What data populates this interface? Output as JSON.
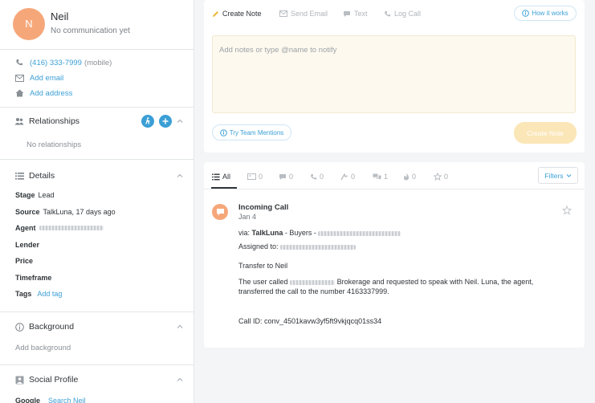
{
  "contact": {
    "initial": "N",
    "name": "Neil",
    "subtitle": "No communication yet",
    "phone": "(416) 333-7999",
    "phone_type": "(mobile)",
    "add_email": "Add email",
    "add_address": "Add address"
  },
  "relationships": {
    "title": "Relationships",
    "empty": "No relationships"
  },
  "details": {
    "title": "Details",
    "stage_label": "Stage",
    "stage_value": "Lead",
    "source_label": "Source",
    "source_value": "TalkLuna, 17 days ago",
    "agent_label": "Agent",
    "lender_label": "Lender",
    "price_label": "Price",
    "timeframe_label": "Timeframe",
    "tags_label": "Tags",
    "add_tag": "Add tag"
  },
  "background": {
    "title": "Background",
    "placeholder": "Add background"
  },
  "social": {
    "title": "Social Profile",
    "google_label": "Google",
    "search_link": "Search Neil"
  },
  "composer": {
    "tabs": [
      "Create Note",
      "Send Email",
      "Text",
      "Log Call"
    ],
    "how_it_works": "How it works",
    "placeholder": "Add notes or type @name to notify",
    "team_mentions": "Try Team Mentions",
    "create_button": "Create Note"
  },
  "feed": {
    "tabs": [
      {
        "label": "All",
        "icon": "list-icon"
      },
      {
        "label": "0",
        "icon": "email-icon"
      },
      {
        "label": "0",
        "icon": "chat-icon"
      },
      {
        "label": "0",
        "icon": "phone-icon"
      },
      {
        "label": "0",
        "icon": "route-icon"
      },
      {
        "label": "1",
        "icon": "comments-icon"
      },
      {
        "label": "0",
        "icon": "fire-icon"
      },
      {
        "label": "0",
        "icon": "star-icon"
      }
    ],
    "filters": "Filters",
    "activity": {
      "title": "Incoming Call",
      "date": "Jan 4",
      "via_prefix": "via:",
      "via_source": "TalkLuna",
      "via_rest": "- Buyers -",
      "assigned": "Assigned to:",
      "transfer": "Transfer to Neil",
      "msg_start": "The user called",
      "msg_mid": "Brokerage and requested to speak with Neil. Luna, the agent,",
      "msg_line2": "transferred the call to the number 4163337999.",
      "call_id": "Call ID: conv_4501kavw3yf5ft9vkjqcq01ss34"
    }
  },
  "colors": {
    "accent": "#3b9fd6",
    "avatar": "#f6a77a",
    "note_bg": "#fdf9ee",
    "create_btn": "#fbe6b8"
  }
}
